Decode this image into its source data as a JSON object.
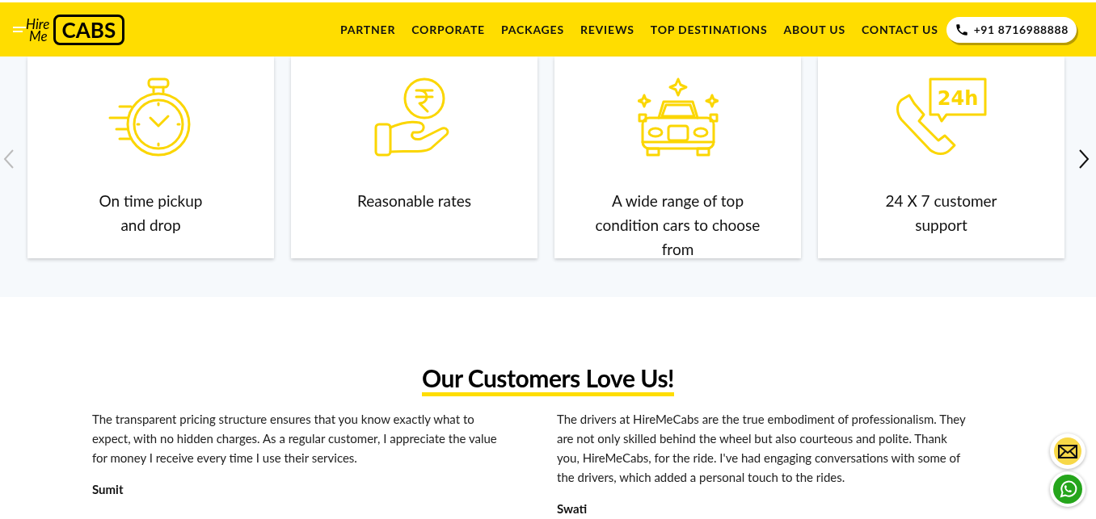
{
  "header": {
    "logo": {
      "line_1": "Hire",
      "line_2": "Me",
      "badge": "CABS"
    },
    "nav": [
      "PARTNER",
      "CORPORATE",
      "PACKAGES",
      "REVIEWS",
      "TOP DESTINATIONS",
      "ABOUT US",
      "CONTACT US"
    ],
    "phone": "+91 8716988888"
  },
  "features": [
    {
      "kind": "stopwatch",
      "text": "On time pickup\nand drop"
    },
    {
      "kind": "rupee",
      "text": "Reasonable rates"
    },
    {
      "kind": "car",
      "text": "A wide range of top\ncondition cars to choose\nfrom"
    },
    {
      "kind": "support",
      "text": "24 X 7 customer\nsupport",
      "icon_text": "24h"
    }
  ],
  "testimonials": {
    "title": "Our Customers Love Us!",
    "items": [
      {
        "text": "The transparent pricing structure ensures that you know exactly what to expect, with no hidden charges. As a regular customer, I appreciate the value for money I receive every time I use their services.",
        "name": "Sumit"
      },
      {
        "text": "The drivers at HireMeCabs are the true embodiment of professionalism. They are not only skilled behind the wheel but also courteous and polite. Thank you, HireMeCabs, for the ride. I've had engaging conversations with some of the drivers, which added a personal touch to the rides.",
        "name": "Swati"
      }
    ]
  }
}
